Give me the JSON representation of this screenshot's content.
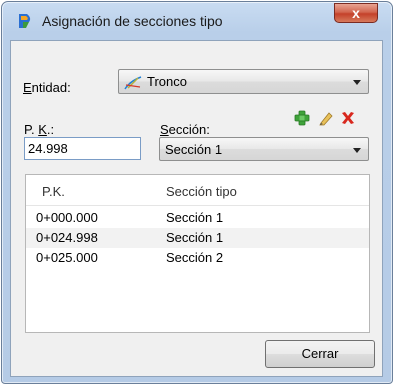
{
  "window": {
    "title": "Asignación de secciones tipo",
    "close_label": "x"
  },
  "entidad": {
    "label_prefix": "",
    "label_underlined": "E",
    "label_suffix": "ntidad:",
    "value": "Tronco"
  },
  "pk": {
    "label_prefix": "P. ",
    "label_underlined": "K",
    "label_suffix": ".:",
    "value": "24.998"
  },
  "seccion": {
    "label_underlined": "S",
    "label_suffix": "ección:",
    "value": "Sección 1"
  },
  "toolbar": {
    "add_icon": "green-plus-icon",
    "edit_icon": "pencil-icon",
    "delete_icon": "red-x-icon"
  },
  "table": {
    "columns": [
      "P.K.",
      "Sección tipo"
    ],
    "rows": [
      [
        "0+000.000",
        "Sección 1"
      ],
      [
        "0+024.998",
        "Sección 1"
      ],
      [
        "0+025.000",
        "Sección 2"
      ]
    ]
  },
  "footer": {
    "close_button": "Cerrar"
  },
  "colors": {
    "title_bar": "#c9dcf2",
    "close_button": "#c4412a",
    "alt_row": "#f2f2f2"
  }
}
